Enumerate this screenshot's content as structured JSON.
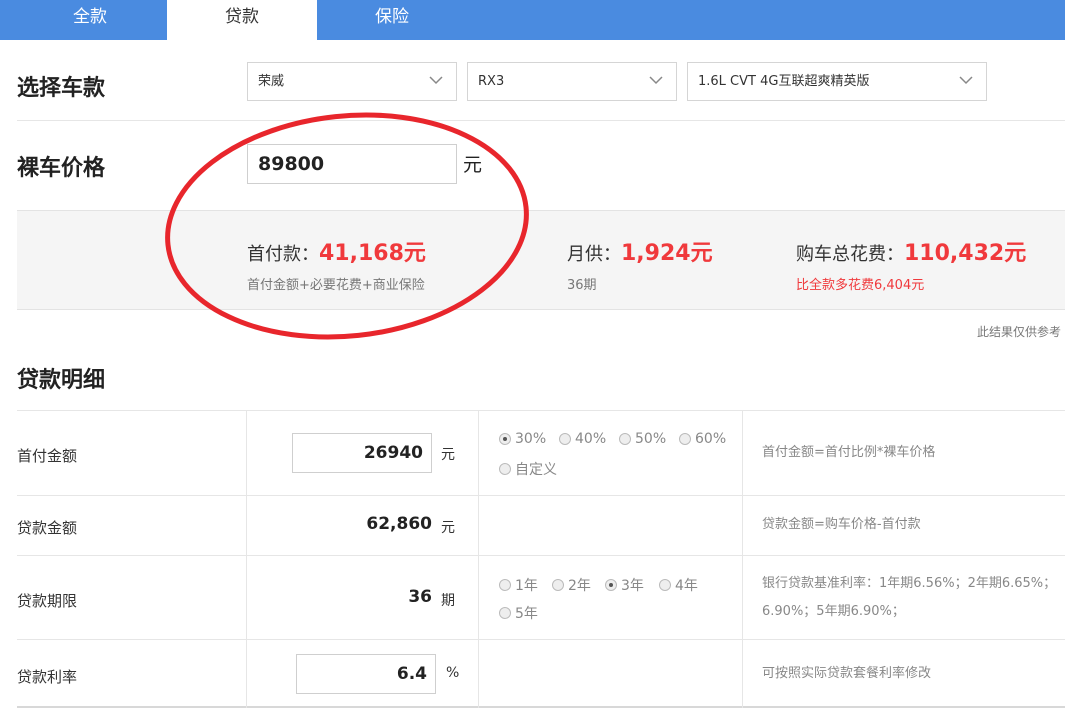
{
  "tabs": [
    {
      "label": "全款"
    },
    {
      "label": "贷款"
    },
    {
      "label": "保险"
    }
  ],
  "car_select": {
    "label": "选择车款",
    "brand": "荣威",
    "model": "RX3",
    "version": "1.6L CVT 4G互联超爽精英版"
  },
  "price": {
    "label": "裸车价格",
    "value": "89800",
    "unit": "元"
  },
  "summary": {
    "down_payment": {
      "label": "首付款：",
      "value": "41,168元",
      "sub": "首付金额+必要花费+商业保险"
    },
    "monthly": {
      "label": "月供：",
      "value": "1,924元",
      "sub": "36期"
    },
    "total": {
      "label": "购车总花费：",
      "value": "110,432元",
      "sub": "比全款多花费6,404元"
    }
  },
  "note": "此结果仅供参考",
  "detail": {
    "title": "贷款明细",
    "down_amount": {
      "label": "首付金额",
      "value": "26940",
      "unit": "元",
      "options": [
        "30%",
        "40%",
        "50%",
        "60%",
        "自定义"
      ],
      "selected": "30%",
      "desc": "首付金额=首付比例*裸车价格"
    },
    "loan_amount": {
      "label": "贷款金额",
      "value": "62,860",
      "unit": "元",
      "desc": "贷款金额=购车价格-首付款"
    },
    "loan_term": {
      "label": "贷款期限",
      "value": "36",
      "unit": "期",
      "options": [
        "1年",
        "2年",
        "3年",
        "4年",
        "5年"
      ],
      "selected": "3年",
      "desc_line1": "银行贷款基准利率：1年期6.56%；2年期6.65%；",
      "desc_line2": "6.90%；5年期6.90%；"
    },
    "rate": {
      "label": "贷款利率",
      "value": "6.4",
      "unit": "%",
      "desc": "可按照实际贷款套餐利率修改"
    }
  },
  "colors": {
    "tab_bar": "#4a8be0",
    "accent_red": "#f0393c",
    "annotation_circle": "#e8262c"
  }
}
